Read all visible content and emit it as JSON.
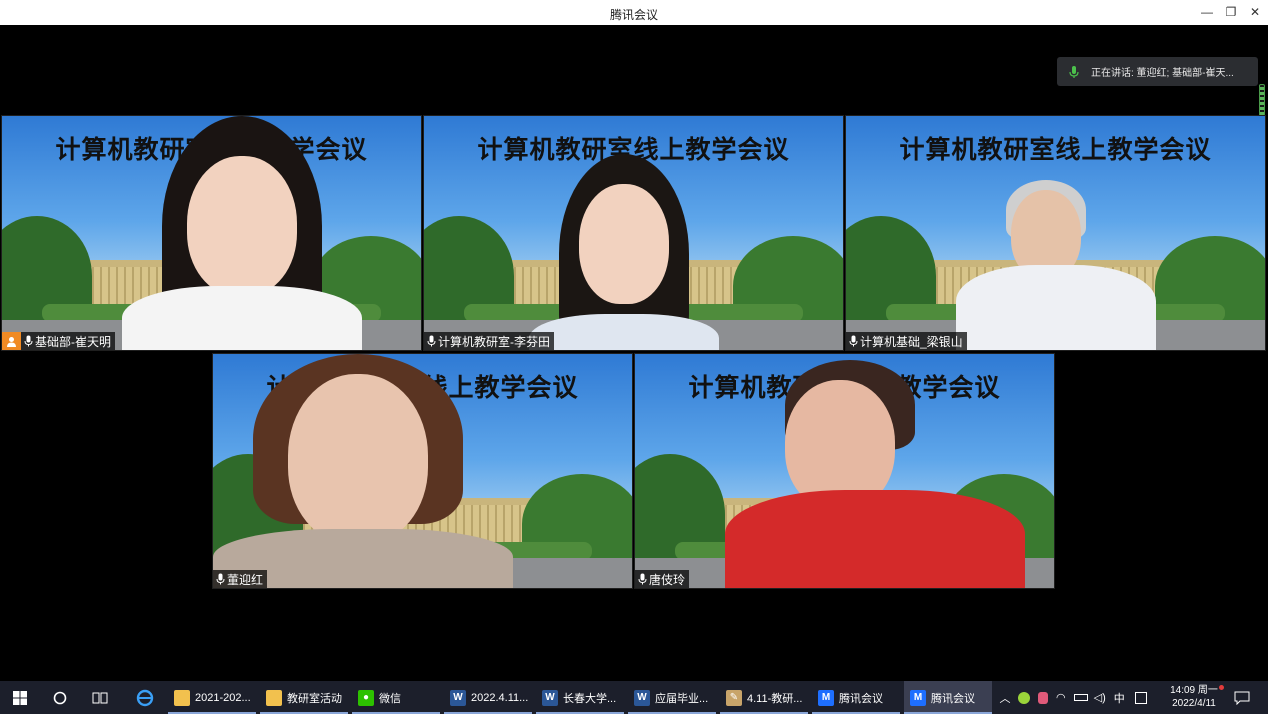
{
  "window": {
    "title": "腾讯会议",
    "minimize_label": "—",
    "maximize_label": "❐",
    "close_label": "✕"
  },
  "speaking_indicator": {
    "text": "正在讲话: 董迎红; 基础部-崔天..."
  },
  "tiles": [
    {
      "name": "基础部-崔天明",
      "banner": "计算机教研室线上教学会议",
      "host": true
    },
    {
      "name": "计算机教研室-李芬田",
      "banner": "计算机教研室线上教学会议",
      "host": false
    },
    {
      "name": "计算机基础_梁银山",
      "banner": "计算机教研室线上教学会议",
      "host": false
    },
    {
      "name": "董迎红",
      "banner": "计算机教研室线上教学会议",
      "host": false
    },
    {
      "name": "唐伎玲",
      "banner": "计算机教研室线上教学会议",
      "host": false
    }
  ],
  "taskbar": {
    "apps": [
      {
        "label": "2021-202...",
        "icon": "folder-icon"
      },
      {
        "label": "教研室活动",
        "icon": "folder-icon"
      },
      {
        "label": "微信",
        "icon": "wechat-icon"
      },
      {
        "label": "2022.4.11...",
        "icon": "word-icon"
      },
      {
        "label": "长春大学...",
        "icon": "word-icon"
      },
      {
        "label": "应届毕业...",
        "icon": "word-icon"
      },
      {
        "label": "4.11-教研...",
        "icon": "paint-icon"
      },
      {
        "label": "腾讯会议",
        "icon": "tencent-meeting-icon"
      },
      {
        "label": "腾讯会议",
        "icon": "tencent-meeting-icon"
      }
    ],
    "ime": "中",
    "time": "14:09 周一",
    "date": "2022/4/11"
  },
  "colors": {
    "titlebar": "#ffffff",
    "taskbar": "#1c1f2b",
    "host_badge": "#f08a24",
    "word": "#2b5797",
    "tencent_meeting": "#1e6fff",
    "folder": "#f2c14e",
    "wechat": "#2dc100"
  }
}
